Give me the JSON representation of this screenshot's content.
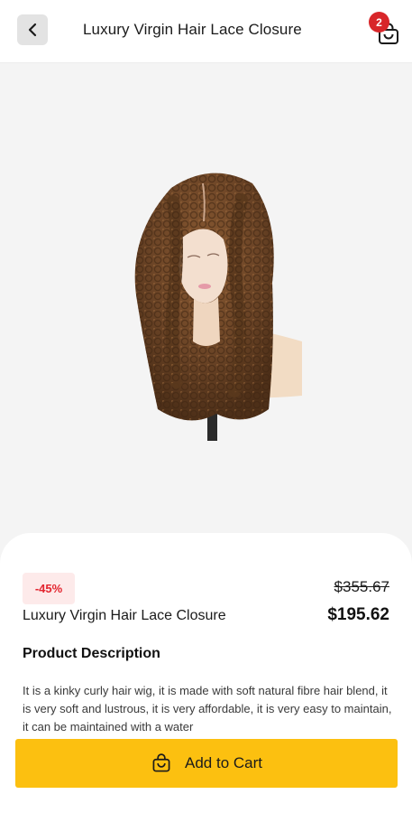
{
  "header": {
    "title": "Luxury Virgin Hair Lace Closure",
    "cart_count": "2",
    "back_icon": "chevron-left-icon",
    "cart_icon": "shopping-bag-icon"
  },
  "product": {
    "discount": "-45%",
    "old_price": "$355.67",
    "price": "$195.62",
    "name": "Luxury Virgin Hair Lace Closure",
    "image": "curly-brown-lace-wig-on-mannequin"
  },
  "description": {
    "heading": "Product Description",
    "text": "It is a kinky curly hair wig, it is made with soft natural fibre hair blend, it is very soft and lustrous, it is very affordable, it is very easy to maintain, it can be maintained with a water"
  },
  "cta": {
    "label": "Add to Cart",
    "icon": "shopping-bag-icon"
  },
  "colors": {
    "accent": "#fcc010",
    "badge": "#d8262a",
    "discount_text": "#e3252f",
    "discount_bg": "#fdeaea"
  }
}
